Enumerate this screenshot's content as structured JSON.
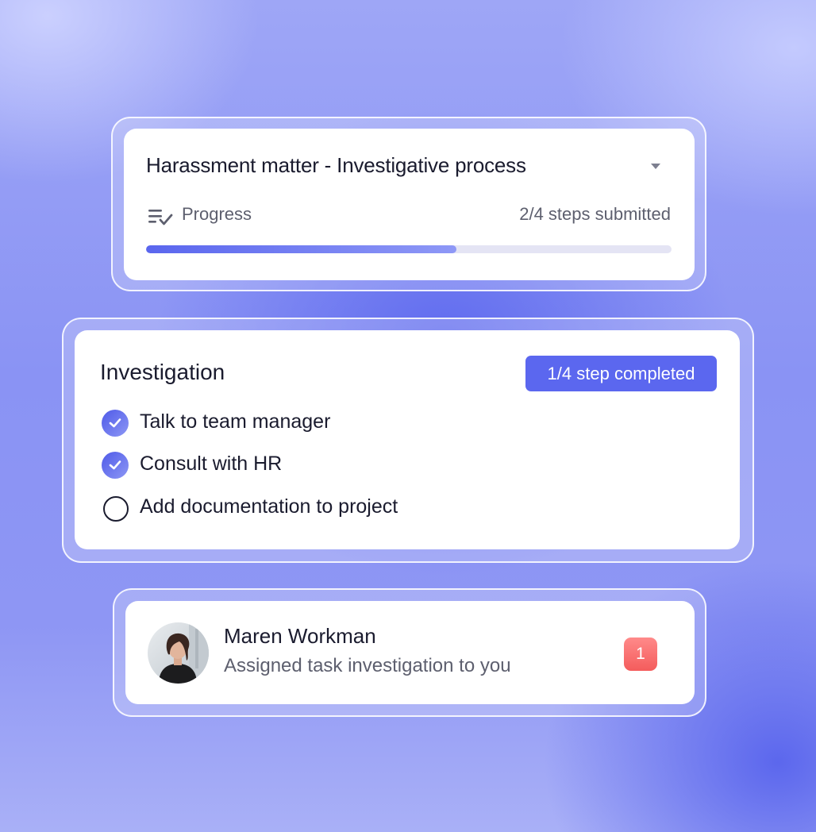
{
  "process_card": {
    "title": "Harassment matter - Investigative process",
    "dropdown_icon": "caret-down-icon",
    "progress_icon": "checklist-icon",
    "progress_label": "Progress",
    "progress_status": "2/4 steps submitted",
    "progress_fraction": 0.59,
    "progress_color": "#5a66ee"
  },
  "investigation_card": {
    "title": "Investigation",
    "badge": "1/4 step completed",
    "badge_color": "#5b67ef",
    "steps": [
      {
        "label": "Talk to team manager",
        "done": true
      },
      {
        "label": "Consult with HR",
        "done": true
      },
      {
        "label": "Add documentation to project",
        "done": false
      }
    ]
  },
  "notification_card": {
    "avatar_icon": "user-avatar",
    "name": "Maren Workman",
    "message": "Assigned task investigation to you",
    "count": "1",
    "count_color": "#f45c5c"
  }
}
